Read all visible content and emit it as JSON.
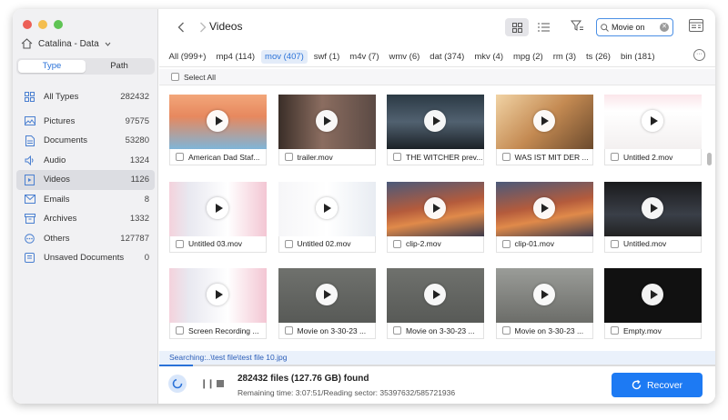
{
  "sidebar": {
    "drive_label": "Catalina - Data",
    "tabs": [
      {
        "label": "Type",
        "active": true
      },
      {
        "label": "Path",
        "active": false
      }
    ],
    "items": [
      {
        "label": "All Types",
        "count": "282432",
        "icon": "grid-icon"
      },
      {
        "label": "Pictures",
        "count": "97575",
        "icon": "picture-icon"
      },
      {
        "label": "Documents",
        "count": "53280",
        "icon": "document-icon"
      },
      {
        "label": "Audio",
        "count": "1324",
        "icon": "audio-icon"
      },
      {
        "label": "Videos",
        "count": "1126",
        "icon": "video-icon",
        "selected": true
      },
      {
        "label": "Emails",
        "count": "8",
        "icon": "email-icon"
      },
      {
        "label": "Archives",
        "count": "1332",
        "icon": "archive-icon"
      },
      {
        "label": "Others",
        "count": "127787",
        "icon": "others-icon"
      },
      {
        "label": "Unsaved Documents",
        "count": "0",
        "icon": "unsaved-document-icon"
      }
    ]
  },
  "toolbar": {
    "title": "Videos",
    "search_value": "Movie on"
  },
  "extensions": [
    {
      "label": "All (999+)",
      "selected": false
    },
    {
      "label": "mp4 (114)",
      "selected": false
    },
    {
      "label": "mov (407)",
      "selected": true
    },
    {
      "label": "swf (1)",
      "selected": false
    },
    {
      "label": "m4v (7)",
      "selected": false
    },
    {
      "label": "wmv (6)",
      "selected": false
    },
    {
      "label": "dat (374)",
      "selected": false
    },
    {
      "label": "mkv (4)",
      "selected": false
    },
    {
      "label": "mpg (2)",
      "selected": false
    },
    {
      "label": "rm (3)",
      "selected": false
    },
    {
      "label": "ts (26)",
      "selected": false
    },
    {
      "label": "bin (181)",
      "selected": false
    }
  ],
  "select_all_label": "Select All",
  "files": [
    {
      "name": "American Dad Staf...",
      "thumb": "cartoon"
    },
    {
      "name": "trailer.mov",
      "thumb": "dark-room"
    },
    {
      "name": "THE WITCHER prev...",
      "thumb": "witcher"
    },
    {
      "name": "WAS IST MIT DER ...",
      "thumb": "food"
    },
    {
      "name": "Untitled 2.mov",
      "thumb": "document-page"
    },
    {
      "name": "Untitled  03.mov",
      "thumb": "screen-pink"
    },
    {
      "name": "Untitled 02.mov",
      "thumb": "screen-white"
    },
    {
      "name": "clip-2.mov",
      "thumb": "mountain"
    },
    {
      "name": "clip-01.mov",
      "thumb": "mountain"
    },
    {
      "name": "Untitled.mov",
      "thumb": "dark-desk"
    },
    {
      "name": "Screen Recording ...",
      "thumb": "screen-pink"
    },
    {
      "name": "Movie on 3-30-23 ...",
      "thumb": "gray"
    },
    {
      "name": "Movie on 3-30-23 ...",
      "thumb": "gray"
    },
    {
      "name": "Movie on 3-30-23 ...",
      "thumb": "gray-sky"
    },
    {
      "name": "Empty.mov",
      "thumb": "black"
    }
  ],
  "status": {
    "searching": "Searching:..\\test file\\test file 10.jpg",
    "found": "282432 files (127.76 GB) found",
    "remaining": "Remaining time: 3:07:51/Reading sector: 35397632/585721936"
  },
  "recover_label": "Recover",
  "accent_color": "#1d7af3"
}
